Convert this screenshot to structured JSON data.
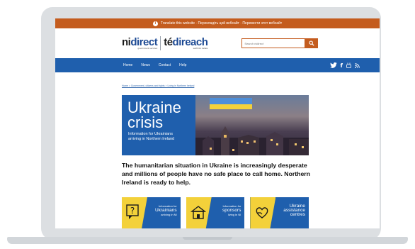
{
  "translate_bar": {
    "text": "Translate this website  ·  Перекладіть цей вебсайт  ·  Перевести этот вебсайт"
  },
  "logo": {
    "ni": "ni",
    "direct": "direct",
    "ni_sub": "government services",
    "te": "té",
    "direach": "direach",
    "te_sub": "seirbhísí rialtais"
  },
  "search": {
    "placeholder": "Search nidirect"
  },
  "nav": {
    "items": [
      "Home",
      "News",
      "Contact",
      "Help"
    ]
  },
  "breadcrumb": "Home > Government, citizens and rights > Living in Northern Ireland",
  "hero": {
    "title_line1": "Ukraine",
    "title_line2": "crisis",
    "subtitle_line1": "Information for Ukrainians",
    "subtitle_line2": "arriving in Northern Ireland"
  },
  "intro": "The humanitarian situation in Ukraine is increasingly desperate and millions of people have no safe place to call home. Northern Ireland is ready to help.",
  "cards": [
    {
      "small_top": "Information for",
      "big": "Ukrainians",
      "small_bottom": "arriving in NI"
    },
    {
      "small_top": "Information for",
      "big": "sponsors",
      "small_bottom": "living in NI"
    },
    {
      "small_top": "",
      "big": "Ukraine assistance centres",
      "small_bottom": ""
    }
  ],
  "colors": {
    "brand_blue": "#1f5fad",
    "brand_orange": "#c45c1e",
    "flag_yellow": "#f3d13a"
  }
}
